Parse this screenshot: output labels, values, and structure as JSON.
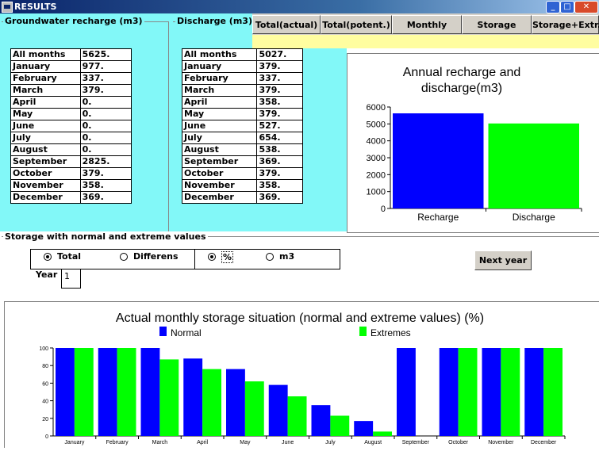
{
  "window": {
    "title": "RESULTS"
  },
  "recharge": {
    "title": "Groundwater recharge (m3)",
    "rows": [
      {
        "month": "All months",
        "value": "5625."
      },
      {
        "month": "January",
        "value": "977."
      },
      {
        "month": "February",
        "value": "337."
      },
      {
        "month": "March",
        "value": "379."
      },
      {
        "month": "April",
        "value": "0."
      },
      {
        "month": "May",
        "value": "0."
      },
      {
        "month": "June",
        "value": "0."
      },
      {
        "month": "July",
        "value": "0."
      },
      {
        "month": "August",
        "value": "0."
      },
      {
        "month": "September",
        "value": "2825."
      },
      {
        "month": "October",
        "value": "379."
      },
      {
        "month": "November",
        "value": "358."
      },
      {
        "month": "December",
        "value": "369."
      }
    ]
  },
  "discharge": {
    "title": "Discharge (m3)",
    "rows": [
      {
        "month": "All months",
        "value": "5027."
      },
      {
        "month": "January",
        "value": "379."
      },
      {
        "month": "February",
        "value": "337."
      },
      {
        "month": "March",
        "value": "379."
      },
      {
        "month": "April",
        "value": "358."
      },
      {
        "month": "May",
        "value": "379."
      },
      {
        "month": "June",
        "value": "527."
      },
      {
        "month": "July",
        "value": "654."
      },
      {
        "month": "August",
        "value": "538."
      },
      {
        "month": "September",
        "value": "369."
      },
      {
        "month": "October",
        "value": "379."
      },
      {
        "month": "November",
        "value": "358."
      },
      {
        "month": "December",
        "value": "369."
      }
    ]
  },
  "tabs": [
    "Total(actual)",
    "Total(potent.)",
    "Monthly",
    "Storage",
    "Storage+Extr."
  ],
  "storage": {
    "group_title": "Storage with normal and extreme values",
    "radio_total": "Total",
    "radio_differens": "Differens",
    "radio_percent": "%",
    "radio_m3": "m3",
    "year_label": "Year",
    "year_value": "1",
    "next_year": "Next year"
  },
  "colors": {
    "blue": "#0000ff",
    "green": "#00ff00",
    "panel": "#82f8f8",
    "yellow": "#fffda0"
  },
  "chart_data": [
    {
      "type": "bar",
      "title": "Annual recharge and discharge(m3)",
      "categories": [
        "Recharge",
        "Discharge"
      ],
      "values": [
        5625,
        5027
      ],
      "colors": [
        "#0000ff",
        "#00ff00"
      ],
      "ylim": [
        0,
        6000
      ],
      "yticks": [
        0,
        1000,
        2000,
        3000,
        4000,
        5000,
        6000
      ],
      "grid": false
    },
    {
      "type": "bar",
      "title": "Actual monthly storage situation (normal and extreme values) (%)",
      "categories": [
        "January",
        "February",
        "March",
        "April",
        "May",
        "June",
        "July",
        "August",
        "September",
        "October",
        "November",
        "December"
      ],
      "series": [
        {
          "name": "Normal",
          "color": "#0000ff",
          "values": [
            100,
            100,
            100,
            88,
            76,
            58,
            35,
            17,
            100,
            100,
            100,
            100
          ]
        },
        {
          "name": "Extremes",
          "color": "#00ff00",
          "values": [
            100,
            100,
            87,
            76,
            62,
            45,
            23,
            5,
            0,
            100,
            100,
            100
          ]
        }
      ],
      "ylim": [
        0,
        100
      ],
      "yticks": [
        0,
        20,
        40,
        60,
        80,
        100
      ],
      "legend": "top",
      "grid": false
    }
  ]
}
